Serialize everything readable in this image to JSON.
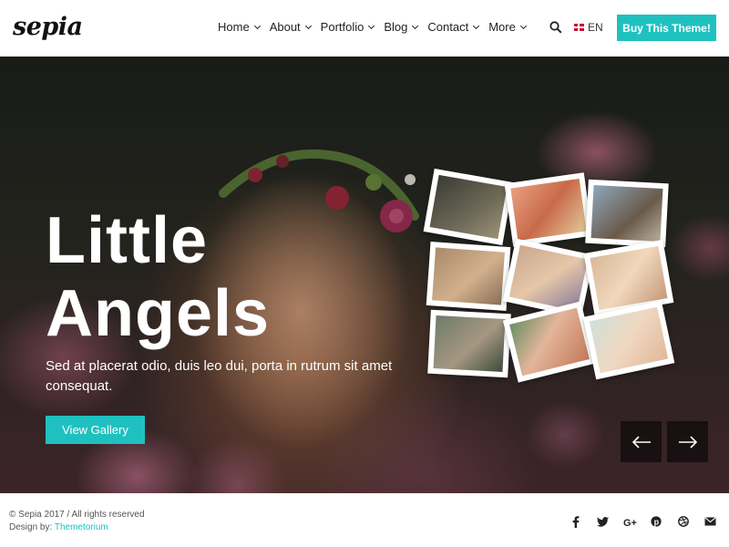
{
  "brand": {
    "logo_text": "sepia"
  },
  "nav": {
    "items": [
      {
        "label": "Home"
      },
      {
        "label": "About"
      },
      {
        "label": "Portfolio"
      },
      {
        "label": "Blog"
      },
      {
        "label": "Contact"
      },
      {
        "label": "More"
      }
    ],
    "search_icon": "search-icon",
    "language": "EN",
    "cta_label": "Buy This Theme!"
  },
  "hero": {
    "title_line1": "Little",
    "title_line2": "Angels",
    "description": "Sed at placerat odio, duis leo dui, porta in rutrum sit amet consequat.",
    "button_label": "View Gallery",
    "prev_icon": "arrow-left-icon",
    "next_icon": "arrow-right-icon"
  },
  "footer": {
    "copyright": "© Sepia 2017 / All rights reserved",
    "design_by_label": "Design by:",
    "design_by_link": "Themetorium",
    "social_icons": [
      "facebook-icon",
      "twitter-icon",
      "google-plus-icon",
      "pinterest-icon",
      "dribbble-icon",
      "email-icon"
    ]
  },
  "colors": {
    "accent": "#1fc1c0",
    "text": "#222222",
    "white": "#ffffff"
  }
}
